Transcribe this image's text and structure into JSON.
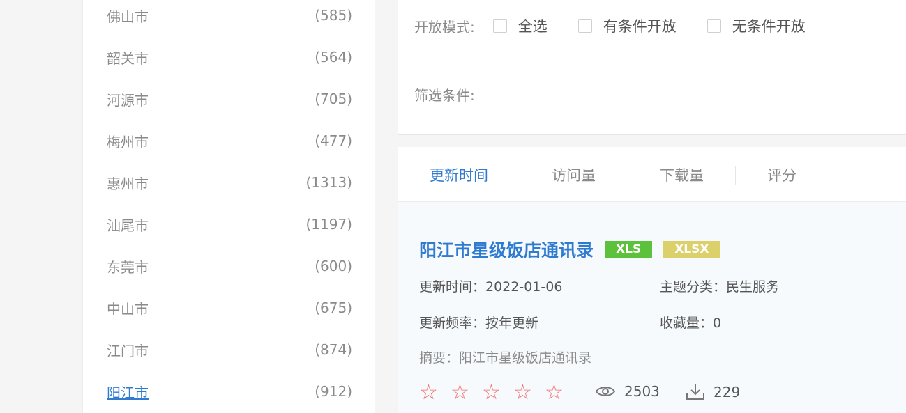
{
  "sidebar": {
    "cities": [
      {
        "name": "佛山市",
        "count": "(585)"
      },
      {
        "name": "韶关市",
        "count": "(564)"
      },
      {
        "name": "河源市",
        "count": "(705)"
      },
      {
        "name": "梅州市",
        "count": "(477)"
      },
      {
        "name": "惠州市",
        "count": "(1313)"
      },
      {
        "name": "汕尾市",
        "count": "(1197)"
      },
      {
        "name": "东莞市",
        "count": "(600)"
      },
      {
        "name": "中山市",
        "count": "(675)"
      },
      {
        "name": "江门市",
        "count": "(874)"
      },
      {
        "name": "阳江市",
        "count": "(912)"
      }
    ],
    "active_city": "阳江市"
  },
  "filters": {
    "open_mode_label": "开放模式:",
    "options": [
      "全选",
      "有条件开放",
      "无条件开放"
    ],
    "conditions_label": "筛选条件:"
  },
  "sort": {
    "tabs": [
      "更新时间",
      "访问量",
      "下载量",
      "评分"
    ],
    "active": "更新时间"
  },
  "dataset": {
    "title": "阳江市星级饭店通讯录",
    "formats": [
      "XLS",
      "XLSX"
    ],
    "update_time": "更新时间：2022-01-06",
    "category": "主题分类：民生服务",
    "frequency": "更新频率：按年更新",
    "favorites": "收藏量：0",
    "summary": "摘要：阳江市星级饭店通讯录",
    "rating_stars": 0,
    "views": "2503",
    "downloads": "229"
  },
  "colors": {
    "accent": "#2f7bd0",
    "xls_badge": "#5cc13b",
    "xlsx_badge": "#dcd06a",
    "star": "#f06b6b"
  }
}
